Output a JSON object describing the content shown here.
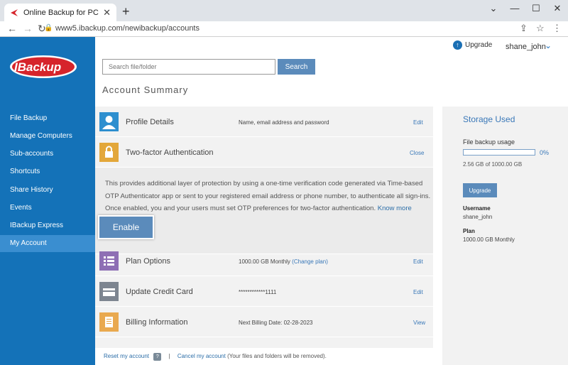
{
  "browser": {
    "tab_title": "Online Backup for PC, Mac and iPhone",
    "url": "www5.ibackup.com/newibackup/accounts"
  },
  "brand": {
    "logo_text": "IBackup",
    "colors": {
      "sidebar": "#1472b8",
      "accent": "#3a78b8",
      "button": "#5b8bbb",
      "logo_red": "#d6242b"
    }
  },
  "sidebar": {
    "items": [
      {
        "label": "File Backup"
      },
      {
        "label": "Manage Computers"
      },
      {
        "label": "Sub-accounts"
      },
      {
        "label": "Shortcuts"
      },
      {
        "label": "Share History"
      },
      {
        "label": "Events"
      },
      {
        "label": "IBackup Express"
      },
      {
        "label": "My Account",
        "active": true
      }
    ]
  },
  "header": {
    "upgrade_label": "Upgrade",
    "username": "shane_john"
  },
  "search": {
    "placeholder": "Search file/folder",
    "button_label": "Search"
  },
  "page": {
    "title": "Account Summary"
  },
  "rows": {
    "profile": {
      "label": "Profile Details",
      "desc": "Name, email address and password",
      "action": "Edit"
    },
    "tfa": {
      "label": "Two-factor Authentication",
      "action": "Close",
      "body": "This provides additional layer of protection by using a one-time verification code generated via Time-based OTP Authenticator app or sent to your registered email address or phone number, to authenticate all sign-ins. Once enabled, you and your users must set OTP preferences for two-factor authentication.",
      "know_more": "Know more",
      "enable_label": "Enable"
    },
    "plan": {
      "label": "Plan Options",
      "desc": "1000.00 GB Monthly",
      "change": "(Change plan)",
      "action": "Edit"
    },
    "card": {
      "label": "Update Credit Card",
      "desc": "************1111",
      "action": "Edit"
    },
    "billing": {
      "label": "Billing Information",
      "desc": "Next Billing Date: 02-28-2023",
      "action": "View"
    }
  },
  "footer": {
    "reset": "Reset my account",
    "help": "?",
    "separator": "|",
    "cancel": "Cancel my account",
    "cancel_note": "(Your files and folders will be removed)."
  },
  "storage": {
    "title": "Storage Used",
    "usage_label": "File backup usage",
    "percent_value": 0,
    "percent_text": "0%",
    "size_text": "2.56 GB of 1000.00 GB",
    "upgrade_label": "Upgrade",
    "username_label": "Username",
    "username_value": "shane_john",
    "plan_label": "Plan",
    "plan_value": "1000.00 GB Monthly"
  }
}
